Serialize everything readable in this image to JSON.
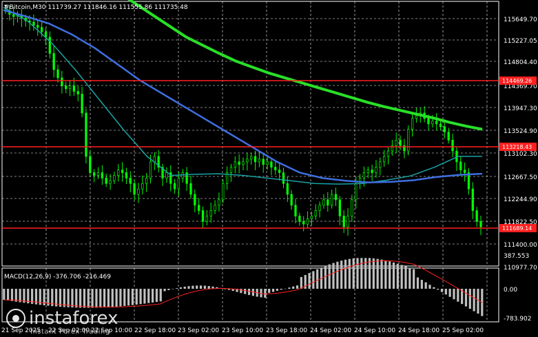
{
  "chart_header": {
    "symbol_line": "#Bitcoin,M30  111739.27 111846.16 111555.86 111735.48",
    "indicator_line": "MACD(12,26,9) -376.706 -216.469"
  },
  "price_axis": {
    "ticks": [
      "115649.70",
      "115227.05",
      "114804.40",
      "114369.70",
      "113947.30",
      "113524.90",
      "113102.30",
      "112667.50",
      "112244.90",
      "111822.50",
      "111400.00",
      "110977.70"
    ]
  },
  "level_tags": {
    "upper": "114469.26",
    "middle": "113218.43",
    "lower": "111689.14"
  },
  "macd_axis": {
    "ticks": [
      "387.553",
      "0.00",
      "-783.902"
    ]
  },
  "time_axis": {
    "labels": [
      "21 Sep 2025",
      "22 Sep 02:00",
      "22 Sep 10:00",
      "22 Sep 18:00",
      "23 Sep 02:00",
      "23 Sep 10:00",
      "23 Sep 18:00",
      "24 Sep 02:00",
      "24 Sep 10:00",
      "24 Sep 18:00",
      "25 Sep 02:00"
    ]
  },
  "watermark": {
    "brand": "instaforex",
    "tagline": "Instant Forex Trading"
  },
  "colors": {
    "background": "#000000",
    "candle": "#00ff00",
    "level_line": "#ff2020",
    "ma_fast_blue": "#3f6fe0",
    "ma_slow_green": "#28e028",
    "ma_teal": "#1aa3a3",
    "macd_hist": "#c0c0c0",
    "macd_signal": "#ff2020",
    "grid": "#ffffff"
  },
  "chart_data": {
    "type": "candlestick",
    "instrument": "#Bitcoin",
    "timeframe": "M30",
    "ohlc_last": {
      "open": 111739.27,
      "high": 111846.16,
      "low": 111555.86,
      "close": 111735.48
    },
    "ylim": [
      110977.7,
      115860
    ],
    "horizontal_levels": [
      114469.26,
      113218.43,
      111689.14
    ],
    "close_series": [
      115690,
      115620,
      115580,
      115600,
      115550,
      115500,
      115480,
      115420,
      115380,
      115300,
      115200,
      114900,
      114600,
      114450,
      114300,
      114250,
      114300,
      114200,
      114150,
      113800,
      113000,
      112700,
      112650,
      112700,
      112600,
      112500,
      112550,
      112650,
      112750,
      112700,
      112600,
      112500,
      112300,
      112400,
      112500,
      112600,
      112900,
      113000,
      112800,
      112600,
      112700,
      112500,
      112400,
      112600,
      112700,
      112500,
      112300,
      112100,
      112000,
      111800,
      111900,
      112000,
      112100,
      112200,
      112500,
      112700,
      112800,
      112900,
      112850,
      112900,
      112950,
      113000,
      112900,
      112950,
      112850,
      112900,
      112800,
      112750,
      112700,
      112500,
      112300,
      112100,
      111900,
      111800,
      111750,
      111850,
      111900,
      112000,
      112100,
      112200,
      112100,
      112300,
      112200,
      111900,
      111700,
      111900,
      112200,
      112500,
      112600,
      112700,
      112750,
      112700,
      112800,
      112900,
      113000,
      113100,
      113200,
      113300,
      113200,
      113100,
      113500,
      113700,
      113750,
      113800,
      113700,
      113600,
      113650,
      113600,
      113550,
      113450,
      113300,
      113100,
      112900,
      112750,
      112700,
      112400,
      112000,
      111800,
      111700
    ],
    "ma_slow_green": [
      116000,
      115800,
      115600,
      115400,
      115200,
      115050,
      114900,
      114760,
      114650,
      114540,
      114450,
      114360,
      114270,
      114180,
      114090,
      114000,
      113920,
      113850,
      113780,
      113710,
      113630,
      113560,
      113500
    ],
    "ma_blue": [
      115700,
      115580,
      115450,
      115250,
      115000,
      114700,
      114400,
      114150,
      113900,
      113650,
      113400,
      113150,
      112900,
      112700,
      112600,
      112550,
      112520,
      112530,
      112560,
      112620,
      112660,
      112680
    ],
    "ma_teal": [
      115750,
      115500,
      115100,
      114600,
      114050,
      113500,
      113000,
      112650,
      112670,
      112680,
      112650,
      112600,
      112550,
      112500,
      112490,
      112500,
      112560,
      112640,
      112800,
      113000,
      113000
    ],
    "macd_hist_shape": "negative early, near zero mid, positive peak around 24 Sep 18:00, turning negative into 25 Sep 02:00",
    "grid": true
  }
}
